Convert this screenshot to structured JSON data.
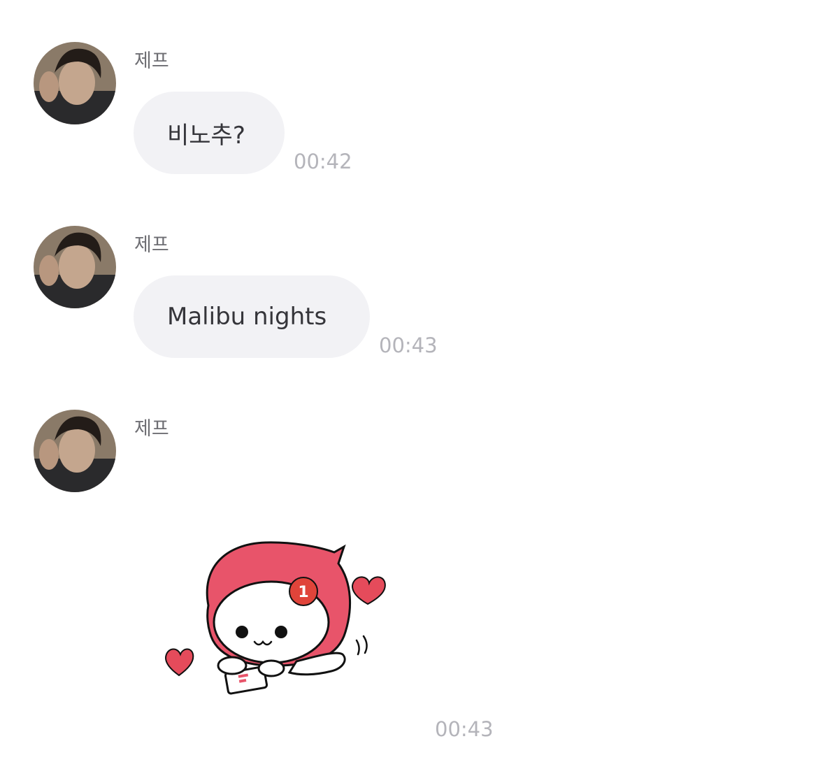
{
  "messages": [
    {
      "sender": "제프",
      "text": "비노추?",
      "time": "00:42"
    },
    {
      "sender": "제프",
      "text": "Malibu nights",
      "time": "00:43"
    },
    {
      "sender": "제프",
      "sticker": "notification-mascot-heart-sticker",
      "sticker_badge": "1",
      "time": "00:43"
    }
  ],
  "colors": {
    "bubble": "#f2f2f5",
    "text": "#35353a",
    "sender": "#6e6e73",
    "time": "#b4b4ba",
    "sticker_hood": "#e8546a",
    "heart": "#e54b5b"
  },
  "icons": {
    "avatar": "user-profile-photo",
    "sticker": "notification-mascot-heart-sticker"
  }
}
